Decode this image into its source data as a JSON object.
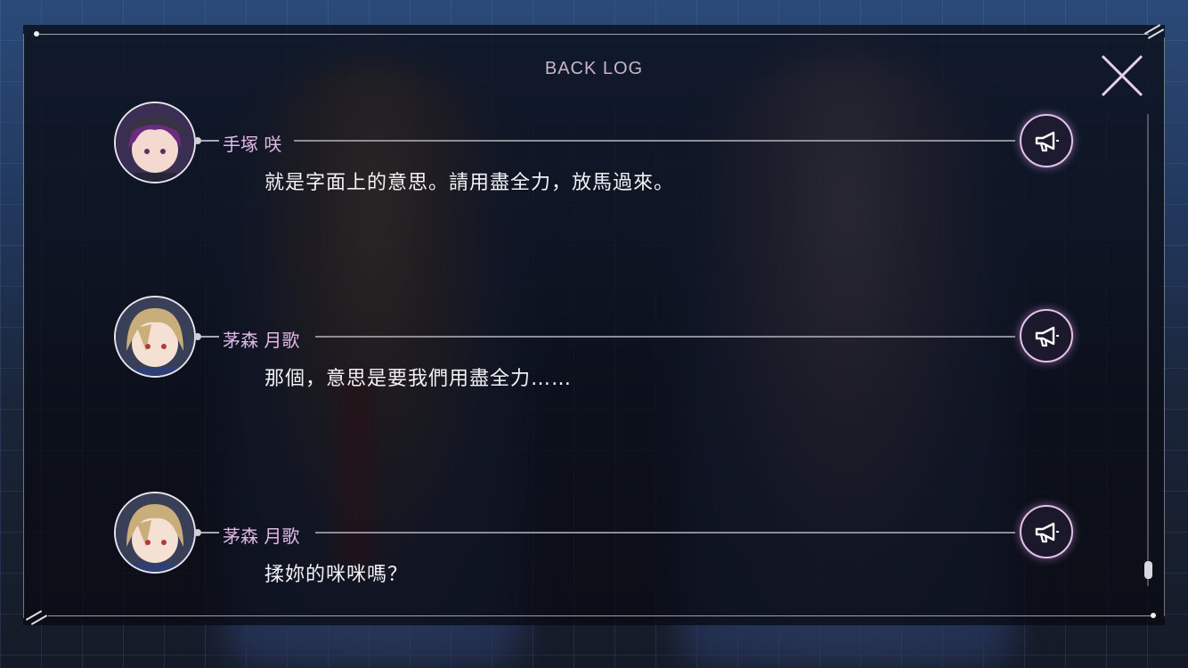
{
  "window": {
    "title": "BACK LOG"
  },
  "entries": [
    {
      "speaker": "手塚 咲",
      "text": "就是字面上的意思。請用盡全力，放馬過來。",
      "avatar": "purple-hair-girl"
    },
    {
      "speaker": "茅森 月歌",
      "text": "那個，意思是要我們用盡全力……",
      "avatar": "blonde-hair-girl"
    },
    {
      "speaker": "茅森 月歌",
      "text": "揉妳的咪咪嗎？",
      "avatar": "blonde-hair-girl"
    }
  ],
  "icons": {
    "close": "close-x-icon",
    "voice": "megaphone-icon"
  },
  "colors": {
    "name": "#e2b7e6",
    "accent": "#e2c3ea",
    "text": "#f2f2f4"
  }
}
